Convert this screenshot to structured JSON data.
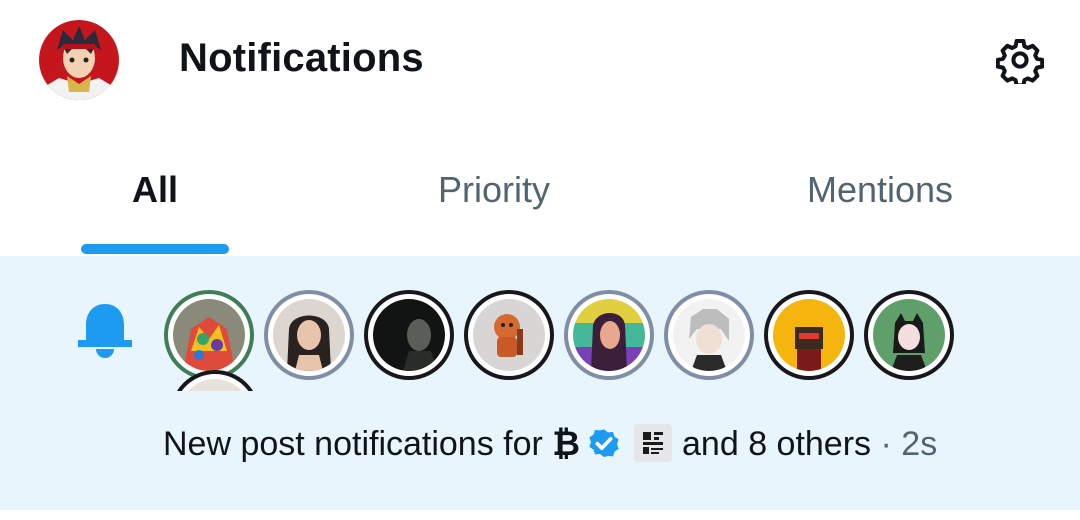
{
  "header": {
    "title": "Notifications",
    "profile_icon": "profile-avatar",
    "settings_icon": "gear-icon"
  },
  "tabs": [
    {
      "label": "All",
      "active": true
    },
    {
      "label": "Priority",
      "active": false
    },
    {
      "label": "Mentions",
      "active": false
    }
  ],
  "notification": {
    "type_icon": "bell-icon",
    "text_prefix": "New post notifications for",
    "account_name": "₿",
    "badge_icon": "verified-badge-icon",
    "second_account_icon": "qr-code-avatar",
    "text_suffix": "and 8 others",
    "separator": "·",
    "time": "2s",
    "avatar_count": 9
  },
  "colors": {
    "accent": "#1d9bf0",
    "notification_bg": "#e8f5fd",
    "secondary_text": "#536471",
    "primary_text": "#0f1419"
  }
}
